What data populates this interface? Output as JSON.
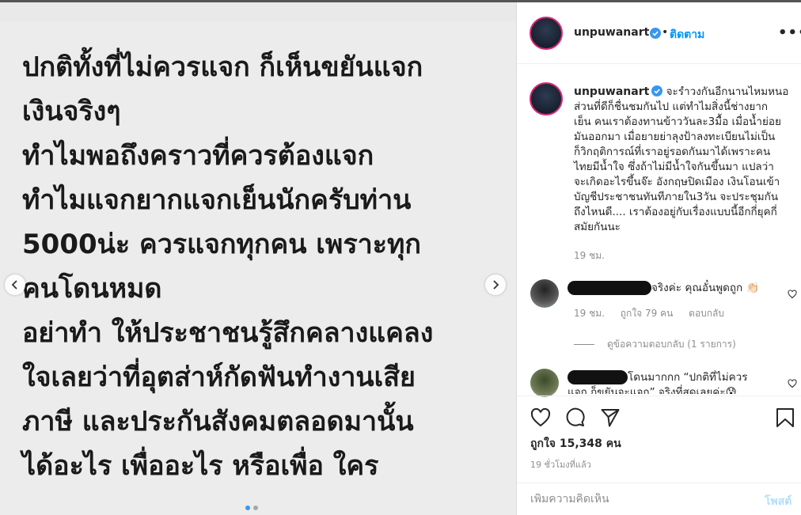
{
  "post": {
    "lines": [
      "ปกติทั้งที่ไม่ควรแจก ก็เห็นขยันแจก",
      "เงินจริงๆ",
      "ทำไมพอถึงคราวที่ควรต้องแจก",
      "ทำไมแจกยากแจกเย็นนักครับท่าน",
      "5000น่ะ ควรแจกทุกคน เพราะทุก",
      "คนโดนหมด",
      "อย่าทำ ให้ประชาชนรู้สึกคลางแคลง",
      "ใจเลยว่าที่อุตส่าห์กัดฟันทำงานเสีย",
      "ภาษี และประกันสังคมตลอดมานั้น",
      "ได้อะไร เพื่ออะไร หรือเพื่อ ใคร"
    ],
    "carousel": {
      "total": 2,
      "active": 1
    }
  },
  "header": {
    "username": "unpuwanart",
    "separator": "•",
    "follow_label": "ติดตาม",
    "more_label": "•••"
  },
  "caption": {
    "username": "unpuwanart",
    "first_line": "จะรำวงกันอีกนานไหมหนอ",
    "lines": [
      "ส่วนที่ดีก็ชื่นชมกันไป แต่ทำไมสิ่งนี้ช่างยาก",
      "เย็น คนเราต้องทานข้าววันละ3มื้อ เมื่อน้ำย่อย",
      "มันออกมา เมื่อยายย่าลุงป้าลงทะเบียนไม่เป็น",
      "ก็วิกฤติการณ์ที่เราอยู่รอดกันมาได้เพราะคน",
      "ไทยมีน้ำใจ ซึ่งถ้าไม่มีน้ำใจกันขึ้นมา แปลว่า",
      "จะเกิดอะไรขึ้นจ๊ะ อังกฤษปิดเมือง เงินโอนเข้า",
      "บัญชีประชาชนทันทีภายใน3วัน จะประชุมกัน",
      "ถึงไหนดี.... เราต้องอยู่กับเรื่องแบบนี้อีกกี่ยุคกี่",
      "สมัยกันนะ"
    ],
    "time": "19 ชม."
  },
  "comments": [
    {
      "text": "จริงค่ะ คุณอั๋นพูดถูก 👏🏻",
      "time": "19 ชม.",
      "likes": "ถูกใจ 79 คน",
      "reply": "ตอบกลับ"
    },
    {
      "text": "โดนมากกก “ปกติที่ไม่ควร",
      "text2": "แจก ก็ขยันจะแจก” จริงที่สุดเลยค่ะ😰"
    }
  ],
  "replies_label": "ดูข้อความตอบกลับ (1 รายการ)",
  "actions": {
    "likes": "ถูกใจ 15,348 คน",
    "time_ago": "19 ชั่วโมงที่แล้ว",
    "comment_placeholder": "เพิ่มความคิดเห็น",
    "post_label": "โพสต์"
  },
  "colors": {
    "link": "#0095f6",
    "verified": "#3897f0",
    "muted": "#8e8e8e"
  }
}
